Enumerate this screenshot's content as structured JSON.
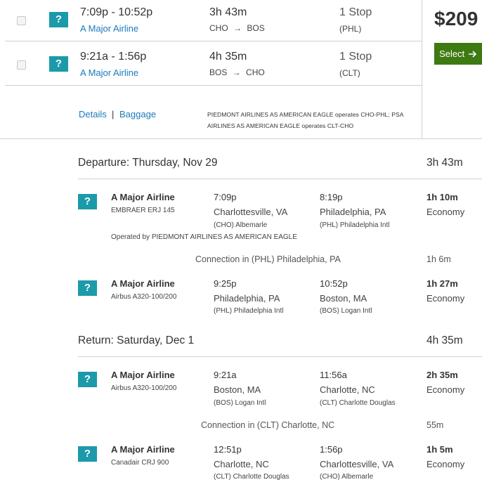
{
  "summary": {
    "price": "$209",
    "select_label": "Select",
    "flights": [
      {
        "times": "7:09p - 10:52p",
        "airline": "A Major Airline",
        "duration": "3h 43m",
        "from": "CHO",
        "to": "BOS",
        "arrow": "→",
        "stops": "1 Stop",
        "via": "(PHL)"
      },
      {
        "times": "9:21a - 1:56p",
        "airline": "A Major Airline",
        "duration": "4h 35m",
        "from": "BOS",
        "to": "CHO",
        "arrow": "→",
        "stops": "1 Stop",
        "via": "(CLT)"
      }
    ],
    "details_label": "Details",
    "separator": "|",
    "baggage_label": "Baggage",
    "operator_note_1": "PIEDMONT AIRLINES AS AMERICAN EAGLE operates CHO-PHL; PSA",
    "operator_note_2": "AIRLINES AS AMERICAN EAGLE operates CLT-CHO"
  },
  "departure": {
    "header": "Departure: Thursday, Nov 29",
    "total": "3h 43m",
    "segments": [
      {
        "airline": "A Major Airline",
        "aircraft": "EMBRAER ERJ 145",
        "dep_time": "7:09p",
        "dep_city": "Charlottesville, VA",
        "dep_airport": "(CHO) Albemarle",
        "arr_time": "8:19p",
        "arr_city": "Philadelphia, PA",
        "arr_airport": "(PHL) Philadelphia Intl",
        "duration": "1h 10m",
        "cabin": "Economy",
        "operated_by": "Operated by PIEDMONT AIRLINES AS AMERICAN EAGLE"
      },
      {
        "airline": "A Major Airline",
        "aircraft": "Airbus A320-100/200",
        "dep_time": "9:25p",
        "dep_city": "Philadelphia, PA",
        "dep_airport": "(PHL) Philadelphia Intl",
        "arr_time": "10:52p",
        "arr_city": "Boston, MA",
        "arr_airport": "(BOS) Logan Intl",
        "duration": "1h 27m",
        "cabin": "Economy"
      }
    ],
    "connection": {
      "text": "Connection in (PHL) Philadelphia, PA",
      "time": "1h 6m"
    }
  },
  "return": {
    "header": "Return: Saturday, Dec 1",
    "total": "4h 35m",
    "segments": [
      {
        "airline": "A Major Airline",
        "aircraft": "Airbus A320-100/200",
        "dep_time": "9:21a",
        "dep_city": "Boston, MA",
        "dep_airport": "(BOS) Logan Intl",
        "arr_time": "11:56a",
        "arr_city": "Charlotte, NC",
        "arr_airport": "(CLT) Charlotte Douglas",
        "duration": "2h 35m",
        "cabin": "Economy"
      },
      {
        "airline": "A Major Airline",
        "aircraft": "Canadair CRJ 900",
        "dep_time": "12:51p",
        "dep_city": "Charlotte, NC",
        "dep_airport": "(CLT) Charlotte Douglas",
        "arr_time": "1:56p",
        "arr_city": "Charlottesville, VA",
        "arr_airport": "(CHO) Albemarle",
        "duration": "1h 5m",
        "cabin": "Economy"
      }
    ],
    "connection": {
      "text": "Connection in (CLT) Charlotte, NC",
      "time": "55m"
    }
  },
  "icons": {
    "airline_logo": "?",
    "select_arrow": "arrow-right-icon"
  },
  "colors": {
    "accent_link": "#1a7bb9",
    "select_button": "#3d7a12",
    "airline_logo": "#1b9aaa"
  }
}
